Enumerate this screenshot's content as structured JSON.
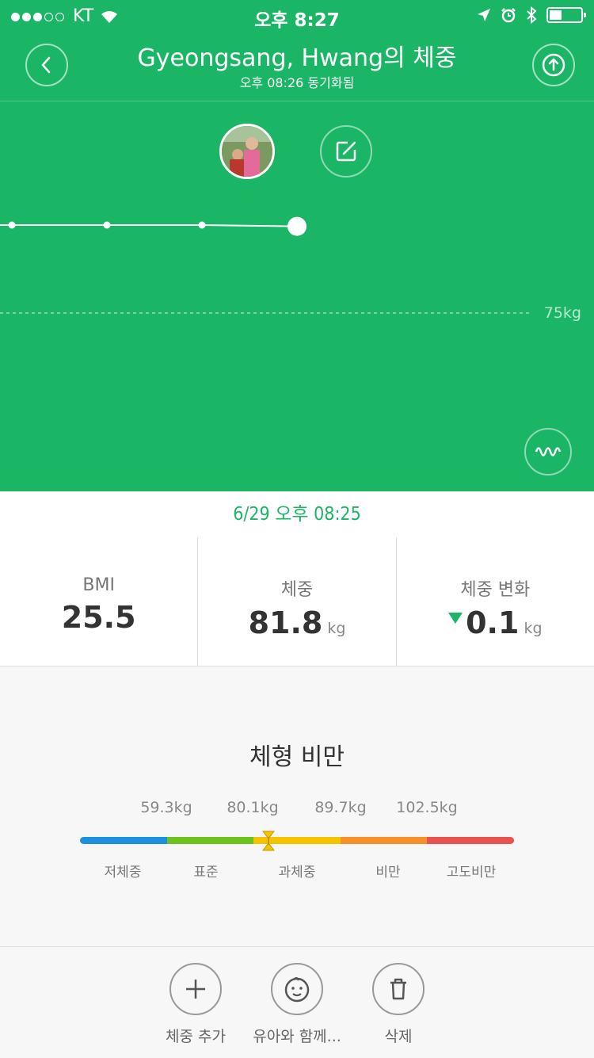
{
  "status_bar": {
    "carrier": "KT",
    "time": "오후 8:27",
    "battery_percent": 40
  },
  "header": {
    "title": "Gyeongsang, Hwang의 체중",
    "subtitle": "오후 08:26 동기화됨",
    "back_icon": "chevron-left-icon",
    "share_icon": "upload-icon"
  },
  "chart": {
    "reference_label": "75kg"
  },
  "chart_data": {
    "type": "line",
    "series": [
      {
        "values": [
          81.9,
          81.9,
          81.9,
          81.8
        ]
      }
    ],
    "reference_lines": [
      {
        "value": 75,
        "label": "75kg"
      }
    ],
    "selected_point_index": 3,
    "grid": false
  },
  "measurement": {
    "datetime": "6/29 오후 08:25",
    "bmi_label": "BMI",
    "bmi_value": "25.5",
    "weight_label": "체중",
    "weight_value": "81.8",
    "weight_unit": "kg",
    "change_label": "체중 변화",
    "change_value": "0.1",
    "change_unit": "kg",
    "change_direction": "down"
  },
  "body_type": {
    "title": "체형 비만",
    "thresholds": [
      "59.3kg",
      "80.1kg",
      "89.7kg",
      "102.5kg"
    ],
    "categories": [
      "저체중",
      "표준",
      "과체중",
      "비만",
      "고도비만"
    ],
    "colors": [
      "#1e90e0",
      "#6cc21e",
      "#f5c400",
      "#f5902a",
      "#e8534f"
    ],
    "marker_position_fraction": 0.435
  },
  "toolbar": {
    "add_label": "체중 추가",
    "baby_label": "유아와 함께...",
    "delete_label": "삭제"
  },
  "colors": {
    "accent": "#1bb566"
  }
}
